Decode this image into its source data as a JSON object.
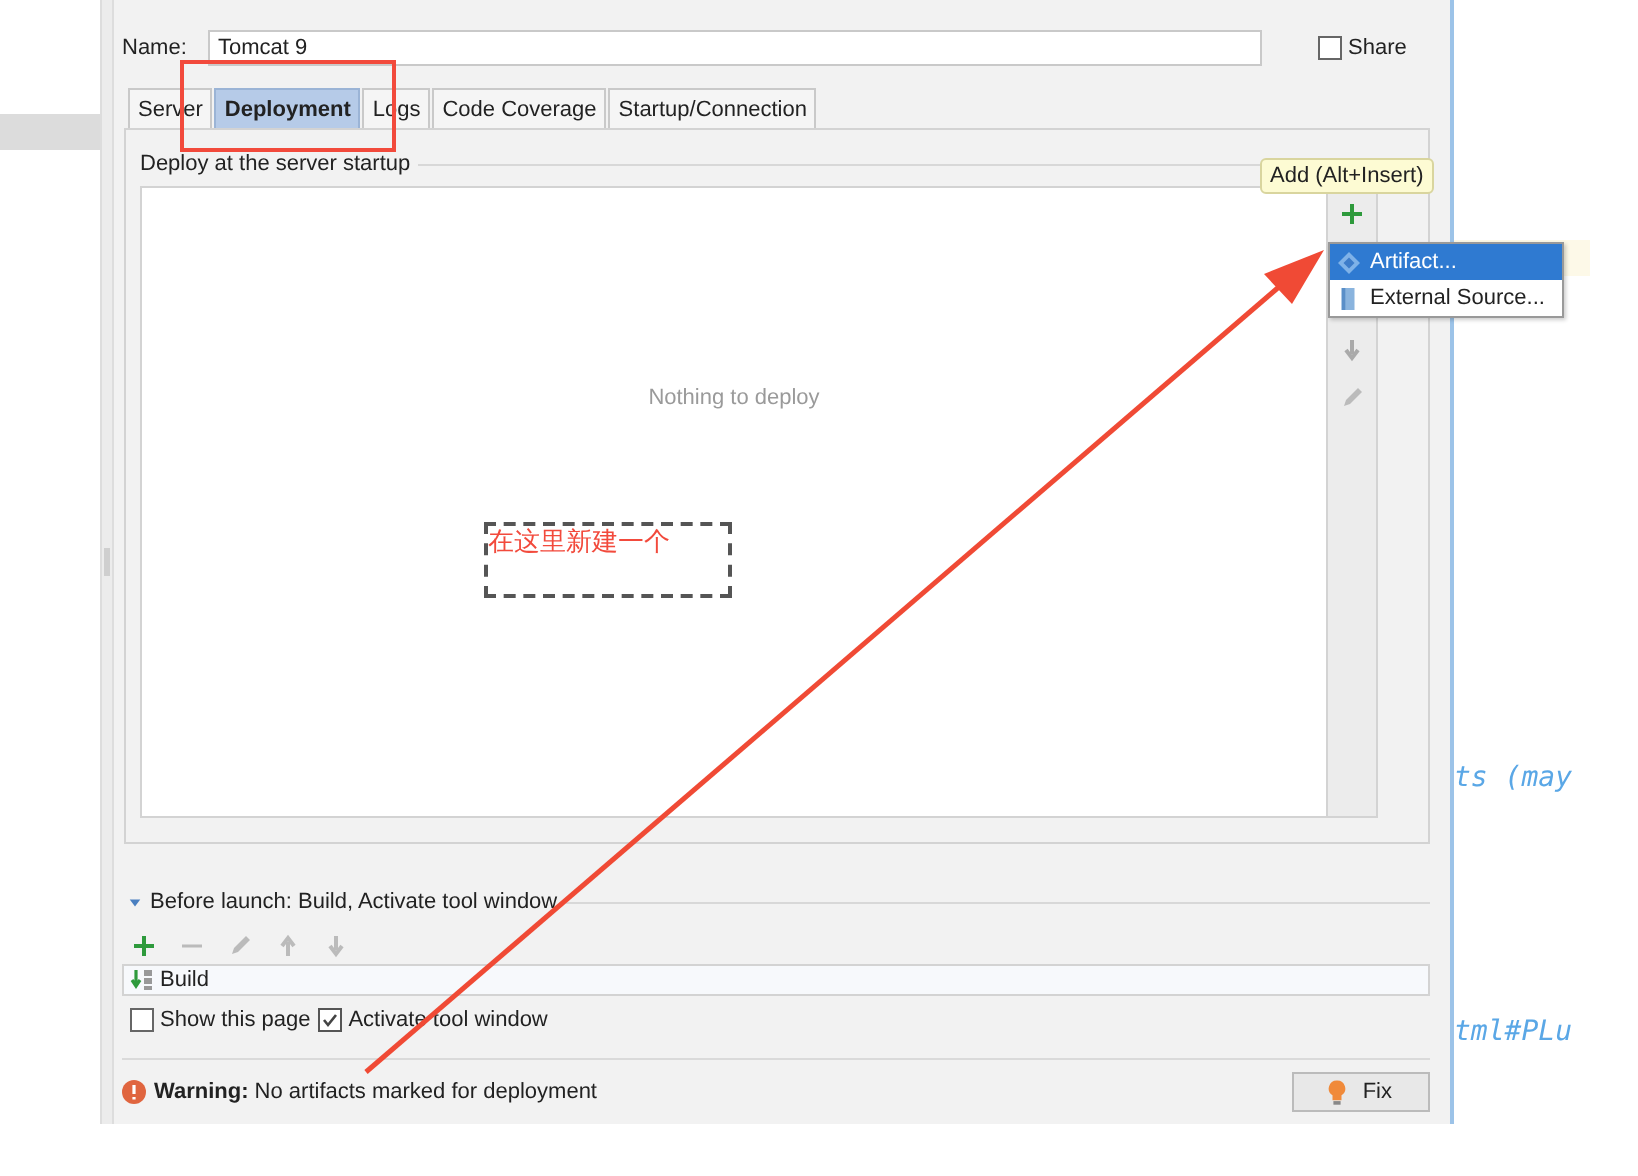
{
  "name_field": {
    "label": "Name:",
    "value": "Tomcat 9"
  },
  "share": {
    "label": "Share",
    "checked": false
  },
  "tabs": [
    {
      "label": "Server",
      "selected": false
    },
    {
      "label": "Deployment",
      "selected": true
    },
    {
      "label": "Logs",
      "selected": false
    },
    {
      "label": "Code Coverage",
      "selected": false
    },
    {
      "label": "Startup/Connection",
      "selected": false
    }
  ],
  "deployment": {
    "group_title": "Deploy at the server startup",
    "empty_text": "Nothing to deploy"
  },
  "add_tooltip": "Add (Alt+Insert)",
  "add_menu": [
    {
      "label": "Artifact...",
      "kind": "artifact",
      "selected": true
    },
    {
      "label": "External Source...",
      "kind": "external",
      "selected": false
    }
  ],
  "before_launch": {
    "title": "Before launch: Build, Activate tool window",
    "expanded": true,
    "tasks": [
      {
        "label": "Build"
      }
    ]
  },
  "options": [
    {
      "label": "Show this page",
      "checked": false
    },
    {
      "label": "Activate tool window",
      "checked": true
    }
  ],
  "warning": "**Warning:** No artifacts marked for deployment",
  "fix_button": "Fix",
  "annotation": "在这里新建一个",
  "editor_fragments": [
    "ts (may",
    "tml#PLu"
  ]
}
